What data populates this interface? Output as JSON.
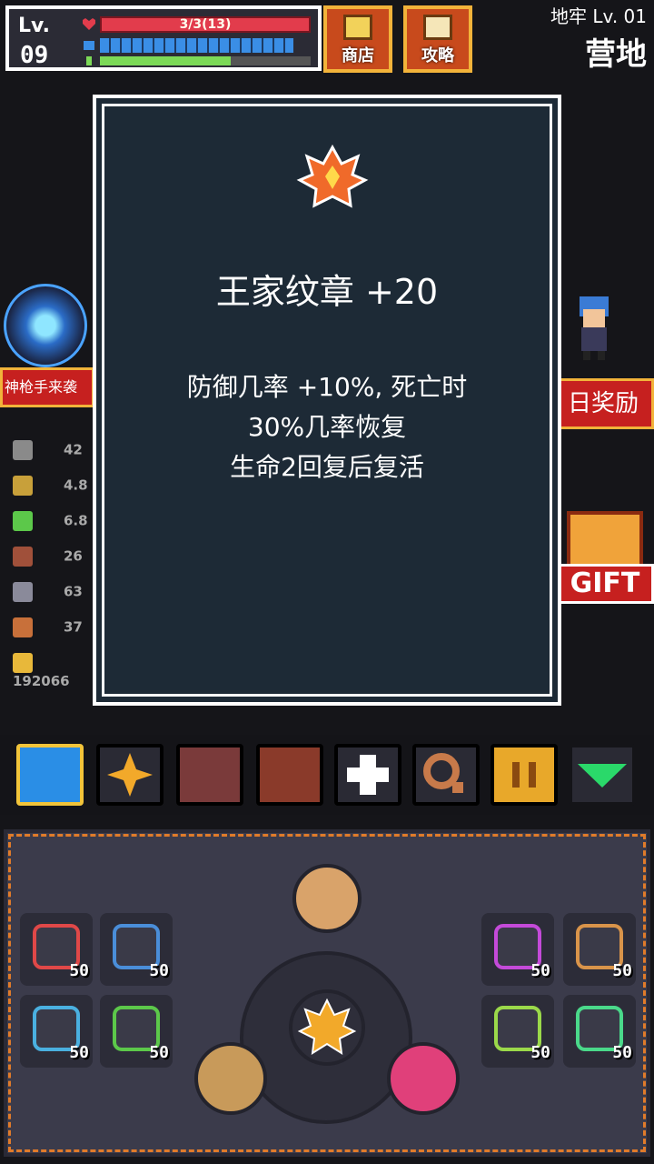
{
  "hud": {
    "level_label": "Lv.",
    "level": "09",
    "hp_text": "3/3(13)",
    "mp_fraction": 0.92,
    "xp_fraction": 0.62
  },
  "buttons": {
    "shop": "商店",
    "guide": "攻略"
  },
  "location": {
    "dungeon": "地牢 Lv. 01",
    "area": "营地"
  },
  "banners": {
    "boss": "神枪手来袭",
    "daily": "日奖励",
    "gift": "GIFT"
  },
  "stats": [
    {
      "icon": "swords-icon",
      "value": "42"
    },
    {
      "icon": "sword-icon",
      "value": "4.8"
    },
    {
      "icon": "boot-icon",
      "value": "6.8"
    },
    {
      "icon": "shield-icon",
      "value": "26"
    },
    {
      "icon": "key-silver-icon",
      "value": "63"
    },
    {
      "icon": "key-bronze-icon",
      "value": "37"
    },
    {
      "icon": "gold-icon",
      "value": "192066"
    }
  ],
  "modal": {
    "item_name": "王家纹章 +20",
    "desc_line1": "防御几率 +10%, 死亡时",
    "desc_line2": "30%几率恢复",
    "desc_line3": "生命2回复后复活"
  },
  "toolbar": [
    "hero",
    "skill",
    "book",
    "bag",
    "heal",
    "search",
    "pause",
    "collapse"
  ],
  "slots": {
    "left": [
      {
        "icon": "triangle-rune-icon",
        "count": "50",
        "color": "#e04848"
      },
      {
        "icon": "triangle-rune-icon",
        "count": "50",
        "color": "#4a8ed9"
      },
      {
        "icon": "square-rune-icon",
        "count": "50",
        "color": "#4ab0e0"
      },
      {
        "icon": "diamond-rune-icon",
        "count": "50",
        "color": "#5cc84a"
      }
    ],
    "right": [
      {
        "icon": "hex-rune-icon",
        "count": "50",
        "color": "#c44ad9"
      },
      {
        "icon": "circle-rune-icon",
        "count": "50",
        "color": "#d9944a"
      },
      {
        "icon": "cross-rune-icon",
        "count": "50",
        "color": "#9bd94a"
      },
      {
        "icon": "spiral-rune-icon",
        "count": "50",
        "color": "#4ad98a"
      }
    ]
  },
  "colors": {
    "accent": "#f2b33a",
    "hp": "#e23c4c",
    "mp": "#3a8ee6",
    "xp": "#7cd957",
    "modal_bg": "#1d2a36"
  }
}
